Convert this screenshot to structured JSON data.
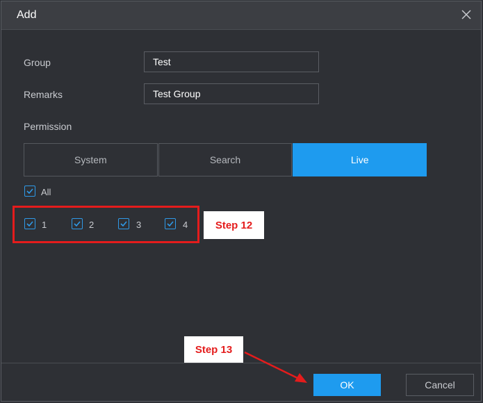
{
  "dialog": {
    "title": "Add",
    "close_icon": "close-icon"
  },
  "form": {
    "group_label": "Group",
    "group_value": "Test",
    "remarks_label": "Remarks",
    "remarks_value": "Test Group",
    "permission_label": "Permission"
  },
  "tabs": [
    {
      "label": "System",
      "active": false
    },
    {
      "label": "Search",
      "active": false
    },
    {
      "label": "Live",
      "active": true
    }
  ],
  "channels": {
    "all_label": "All",
    "all_checked": true,
    "items": [
      {
        "label": "1",
        "checked": true
      },
      {
        "label": "2",
        "checked": true
      },
      {
        "label": "3",
        "checked": true
      },
      {
        "label": "4",
        "checked": true
      }
    ]
  },
  "footer": {
    "ok_label": "OK",
    "cancel_label": "Cancel"
  },
  "annotations": {
    "step12": "Step 12",
    "step13": "Step 13",
    "highlight_color": "#e41c1c"
  },
  "colors": {
    "accent": "#1e9bef",
    "background": "#2e3035",
    "titlebar": "#3c3e43"
  }
}
